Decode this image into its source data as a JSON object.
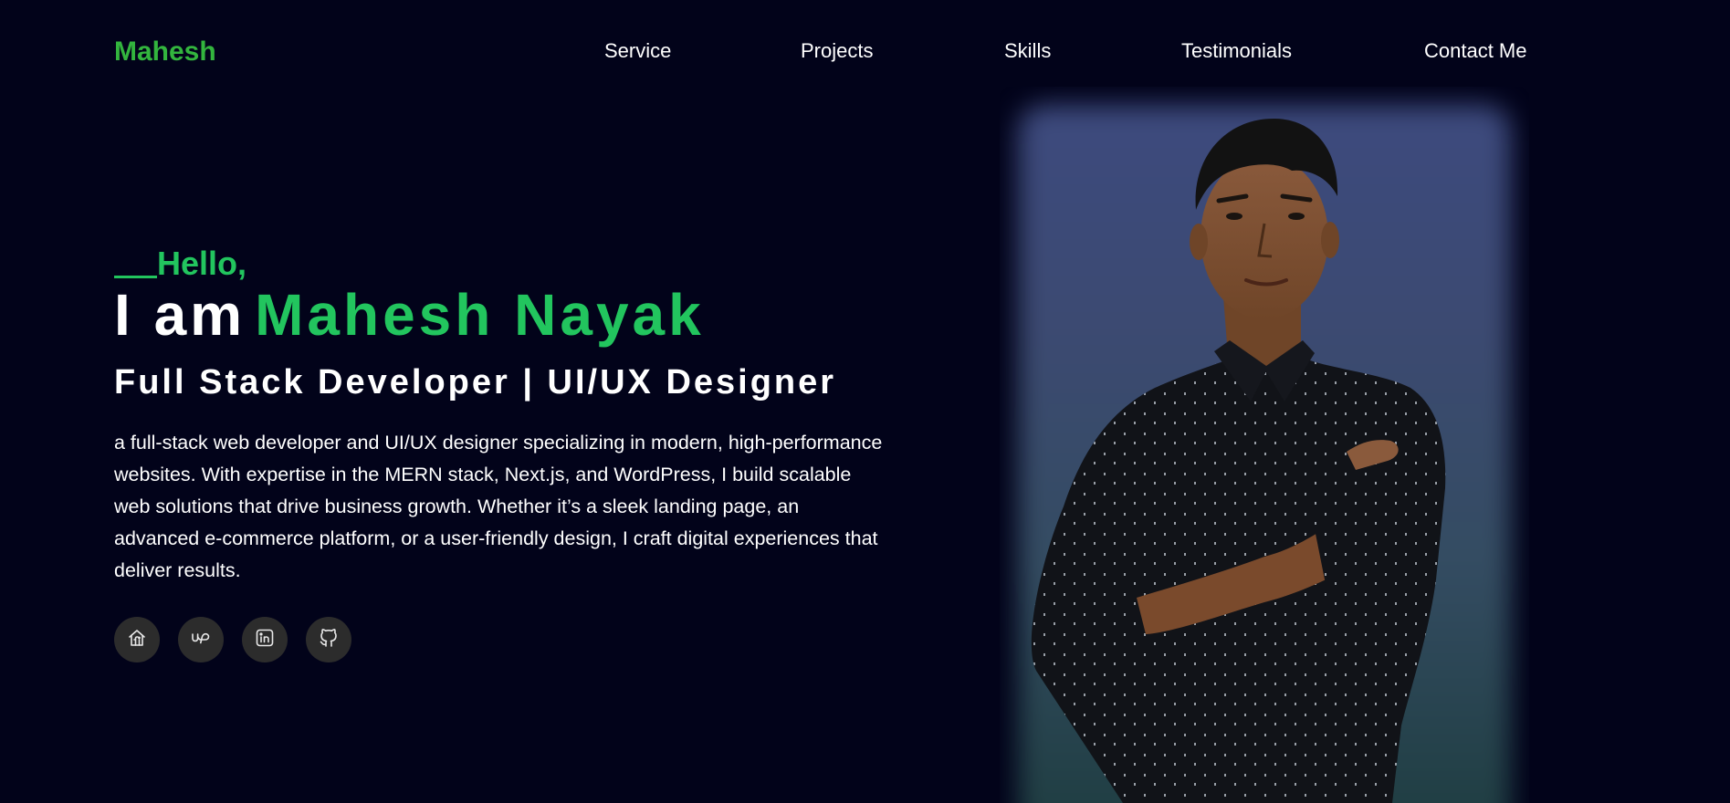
{
  "nav": {
    "logo": "Mahesh",
    "links": [
      "Service",
      "Projects",
      "Skills",
      "Testimonials",
      "Contact Me"
    ]
  },
  "hero": {
    "greeting": "Hello,",
    "intro_prefix": "I am",
    "name": "Mahesh Nayak",
    "role": "Full Stack Developer | UI/UX Designer",
    "bio": "a full-stack web developer and UI/UX designer specializing in modern, high-performance websites. With expertise in the MERN stack, Next.js, and WordPress, I build scalable web solutions that drive business growth. Whether it’s a sleek landing page, an advanced e-commerce platform, or a user-friendly design, I craft digital experiences that deliver results."
  },
  "social": [
    {
      "icon": "fiverr-icon"
    },
    {
      "icon": "upwork-icon"
    },
    {
      "icon": "linkedin-icon"
    },
    {
      "icon": "github-icon"
    }
  ],
  "portrait": {
    "subject": "portrait-photo"
  },
  "colors": {
    "background": "#02031a",
    "accent": "#22c55e",
    "logo": "#33b53e",
    "text": "#ffffff",
    "social_button_bg": "#2c2c2c"
  }
}
